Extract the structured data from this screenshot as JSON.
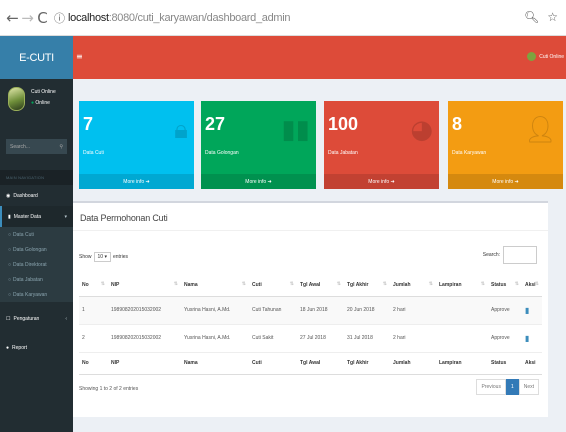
{
  "browser": {
    "url_host": "localhost",
    "url_port": ":8080",
    "url_path": "/cuti_karyawan/dashboard_admin"
  },
  "app": {
    "brand": "E-CUTI"
  },
  "user": {
    "name": "Cuti Online",
    "status": "Online"
  },
  "sidebar": {
    "search_placeholder": "Search...",
    "header": "MAIN NAVIGATION",
    "items": [
      {
        "label": "Dashboard",
        "icon": "dashboard-icon"
      },
      {
        "label": "Master Data",
        "icon": "files-icon"
      },
      {
        "label": "Pengaturan",
        "icon": "settings-icon"
      },
      {
        "label": "Report",
        "icon": "report-icon"
      }
    ],
    "subitems": [
      "Data Cuti",
      "Data Golongan",
      "Data Direktorat",
      "Data Jabatan",
      "Data Karyawan"
    ]
  },
  "topbar": {
    "username": "Cuti Online"
  },
  "stats": [
    {
      "value": "7",
      "label": "Data Cuti",
      "footer": "More info",
      "color": "#00c0ef"
    },
    {
      "value": "27",
      "label": "Data Golongan",
      "footer": "More info",
      "color": "#00a65a"
    },
    {
      "value": "100",
      "label": "Data Jabatan",
      "footer": "More info",
      "color": "#dd4b39"
    },
    {
      "value": "8",
      "label": "Data Karyawan",
      "footer": "More info",
      "color": "#f39c12"
    }
  ],
  "table_box": {
    "title": "Data Permohonan Cuti",
    "show": "Show",
    "entries_value": "10",
    "entries": "entries",
    "search_label": "Search:",
    "columns": [
      "No",
      "NIP",
      "Nama",
      "Cuti",
      "Tgl Awal",
      "Tgl Akhir",
      "Jumlah",
      "Lampiran",
      "Status",
      "Aksi"
    ],
    "rows": [
      [
        "1",
        "198908202015032002",
        "Yusrina Hasni, A.Md.",
        "Cuti Tahunan",
        "18 Jun 2018",
        "20 Jun 2018",
        "2 hari",
        "",
        "Approve"
      ],
      [
        "2",
        "198908202015032002",
        "Yusrina Hasni, A.Md.",
        "Cuti Sakit",
        "27 Jul 2018",
        "31 Jul 2018",
        "2 hari",
        "",
        "Approve"
      ]
    ],
    "info": "Showing 1 to 2 of 2 entries",
    "pagination": {
      "previous": "Previous",
      "current": "1",
      "next": "Next"
    }
  }
}
